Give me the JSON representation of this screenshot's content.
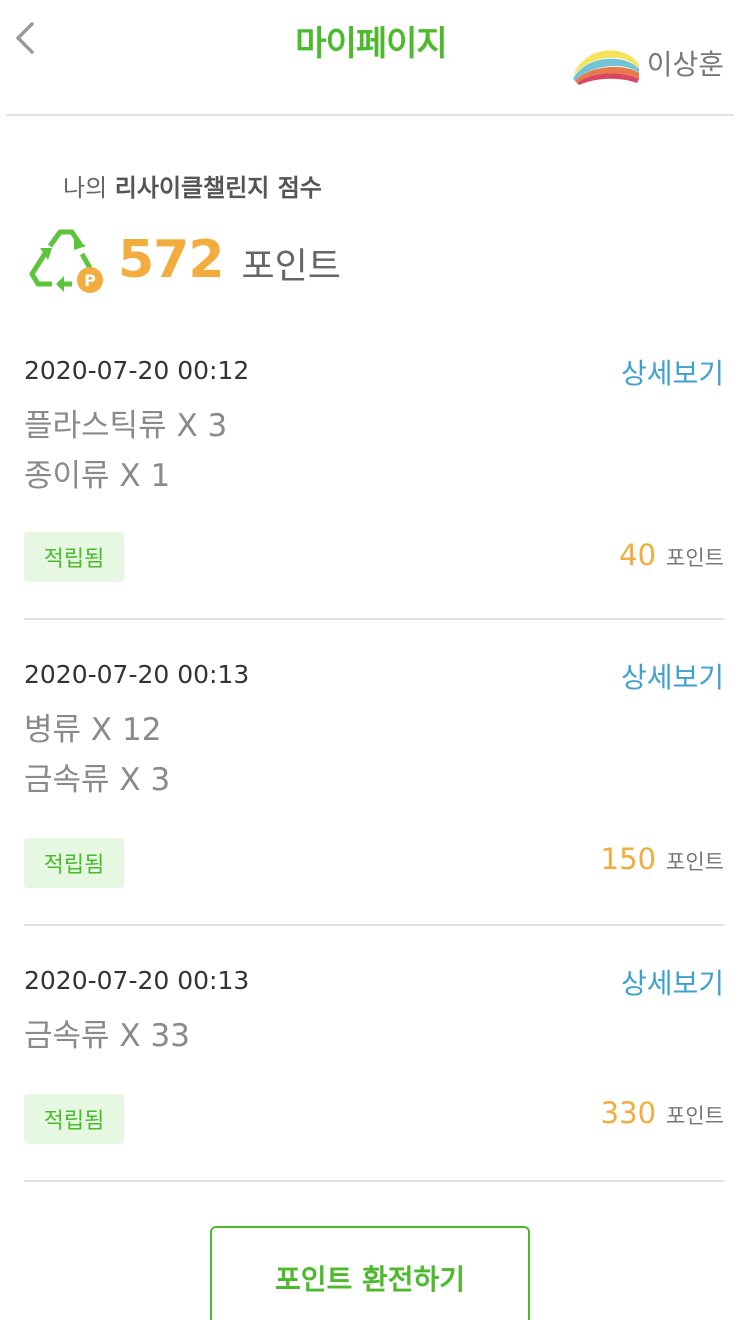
{
  "header": {
    "title": "마이페이지",
    "user_name": "이상훈",
    "back_icon": "chevron-left-icon",
    "avatar_icon": "rainbow-logo-icon"
  },
  "score": {
    "label_prefix": "나의 ",
    "label_bold": "리사이클챌린지 점수",
    "value": "572",
    "unit": "포인트",
    "icon": "recycle-points-icon"
  },
  "records": [
    {
      "date": "2020-07-20 00:12",
      "detail_label": "상세보기",
      "items": [
        "플라스틱류 X 3",
        "종이류 X 1"
      ],
      "status": "적립됨",
      "points": "40",
      "points_unit": "포인트"
    },
    {
      "date": "2020-07-20 00:13",
      "detail_label": "상세보기",
      "items": [
        "병류 X 12",
        "금속류 X 3"
      ],
      "status": "적립됨",
      "points": "150",
      "points_unit": "포인트"
    },
    {
      "date": "2020-07-20 00:13",
      "detail_label": "상세보기",
      "items": [
        "금속류 X 33"
      ],
      "status": "적립됨",
      "points": "330",
      "points_unit": "포인트"
    }
  ],
  "convert_button": {
    "label": "포인트 환전하기"
  },
  "colors": {
    "brand_green": "#4cba2c",
    "points_orange": "#f2ad3e",
    "link_blue": "#3fa1d0",
    "badge_bg": "#e6f7e2"
  }
}
